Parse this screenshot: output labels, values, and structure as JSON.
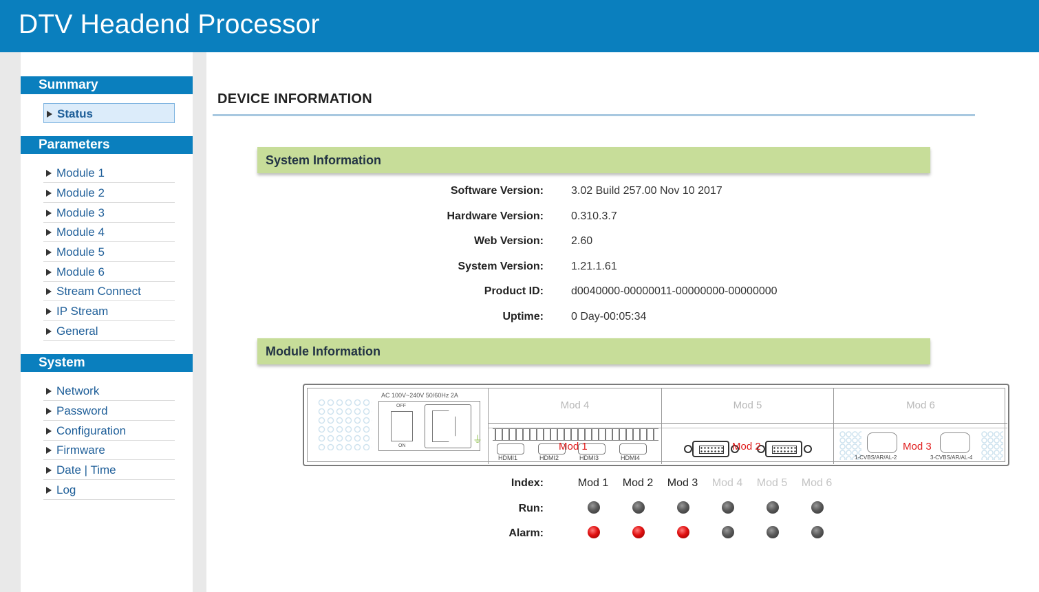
{
  "app": {
    "title": "DTV Headend Processor"
  },
  "sidebar": {
    "summary": {
      "header": "Summary",
      "items": [
        {
          "label": "Status",
          "active": true
        }
      ]
    },
    "parameters": {
      "header": "Parameters",
      "items": [
        {
          "label": "Module 1"
        },
        {
          "label": "Module 2"
        },
        {
          "label": "Module 3"
        },
        {
          "label": "Module 4"
        },
        {
          "label": "Module 5"
        },
        {
          "label": "Module 6"
        },
        {
          "label": "Stream Connect"
        },
        {
          "label": "IP Stream"
        },
        {
          "label": "General"
        }
      ]
    },
    "system": {
      "header": "System",
      "items": [
        {
          "label": "Network"
        },
        {
          "label": "Password"
        },
        {
          "label": "Configuration"
        },
        {
          "label": "Firmware"
        },
        {
          "label": "Date | Time"
        },
        {
          "label": "Log"
        }
      ]
    }
  },
  "main": {
    "page_title": "DEVICE INFORMATION",
    "system_info": {
      "header": "System Information",
      "rows": [
        {
          "label": "Software Version:",
          "value": "3.02 Build 257.00 Nov 10 2017"
        },
        {
          "label": "Hardware Version:",
          "value": "0.310.3.7"
        },
        {
          "label": "Web Version:",
          "value": "2.60"
        },
        {
          "label": "System Version:",
          "value": "1.21.1.61"
        },
        {
          "label": "Product ID:",
          "value": "d0040000-00000011-00000000-00000000"
        },
        {
          "label": "Uptime:",
          "value": "0 Day-00:05:34"
        }
      ]
    },
    "module_info": {
      "header": "Module Information",
      "device": {
        "psu_text": "AC 100V~240V 50/60Hz 2A",
        "switch_off": "OFF",
        "switch_on": "ON",
        "slot_labels": [
          "Mod 4",
          "Mod 5",
          "Mod 6"
        ],
        "mod_overlays": [
          "Mod 1",
          "Mod 2",
          "Mod 3"
        ],
        "hdmi_labels": [
          "HDMI1",
          "HDMI2",
          "HDMI3",
          "HDMI4"
        ],
        "cvbs_labels": [
          "1-CVBS/AR/AL-2",
          "3-CVBS/AR/AL-4"
        ]
      },
      "status": {
        "index_label": "Index:",
        "run_label": "Run:",
        "alarm_label": "Alarm:",
        "modules": [
          {
            "name": "Mod 1",
            "enabled": true,
            "run": "grey",
            "alarm": "red"
          },
          {
            "name": "Mod 2",
            "enabled": true,
            "run": "grey",
            "alarm": "red"
          },
          {
            "name": "Mod 3",
            "enabled": true,
            "run": "grey",
            "alarm": "red"
          },
          {
            "name": "Mod 4",
            "enabled": false,
            "run": "grey",
            "alarm": "grey"
          },
          {
            "name": "Mod 5",
            "enabled": false,
            "run": "grey",
            "alarm": "grey"
          },
          {
            "name": "Mod 6",
            "enabled": false,
            "run": "grey",
            "alarm": "grey"
          }
        ]
      }
    }
  },
  "colors": {
    "header_blue": "#0a7fbe",
    "panel_green": "#c7dd99",
    "link_blue": "#1f5f99",
    "led_red": "#e01010",
    "led_grey": "#5a5a5a",
    "mod_label_red": "#e01a1a"
  }
}
